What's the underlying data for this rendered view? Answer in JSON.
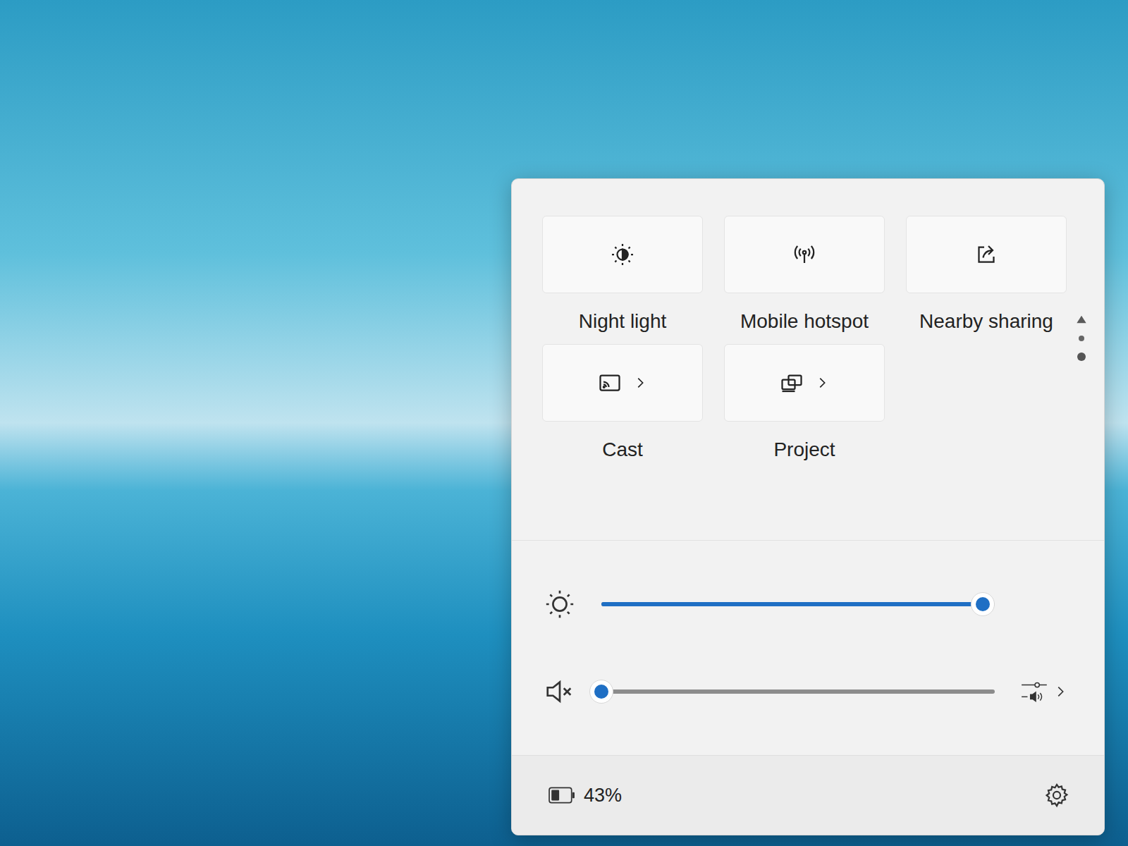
{
  "quick_settings": {
    "tiles": [
      {
        "label": "Night light",
        "kind": "toggle",
        "on": false
      },
      {
        "label": "Mobile hotspot",
        "kind": "toggle",
        "on": false
      },
      {
        "label": "Nearby sharing",
        "kind": "toggle",
        "on": false
      },
      {
        "label": "Cast",
        "kind": "expand",
        "on": false
      },
      {
        "label": "Project",
        "kind": "expand",
        "on": false
      }
    ],
    "pages": [
      {
        "selected": false
      },
      {
        "selected": true
      }
    ],
    "brightness": {
      "level": 0.97
    },
    "volume": {
      "level": 0,
      "muted": true
    },
    "battery": {
      "reading": "43%",
      "level": 0.43
    }
  }
}
